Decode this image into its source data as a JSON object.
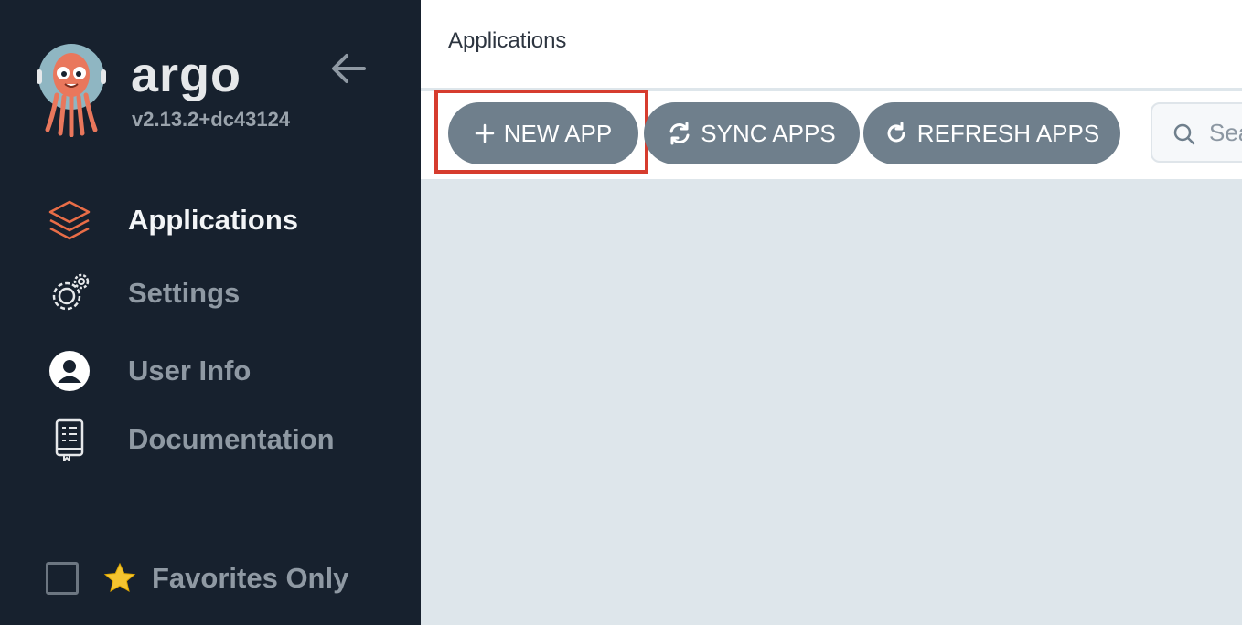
{
  "sidebar": {
    "brand": "argo",
    "version": "v2.13.2+dc43124",
    "items": [
      {
        "label": "Applications",
        "icon": "stack-layers-icon",
        "active": true
      },
      {
        "label": "Settings",
        "icon": "gears-icon",
        "active": false
      },
      {
        "label": "User Info",
        "icon": "user-circle-icon",
        "active": false
      },
      {
        "label": "Documentation",
        "icon": "book-icon",
        "active": false
      }
    ],
    "favorites_label": "Favorites Only",
    "favorites_checked": false
  },
  "header": {
    "title": "Applications"
  },
  "toolbar": {
    "new_app": "NEW APP",
    "sync_apps": "SYNC APPS",
    "refresh_apps": "REFRESH APPS",
    "search_placeholder": "Search"
  },
  "colors": {
    "sidebar_bg": "#17212e",
    "button_bg": "#6f7f8c",
    "highlight": "#d63c2e",
    "accent_orange": "#e96d47",
    "content_bg": "#dee6eb"
  }
}
